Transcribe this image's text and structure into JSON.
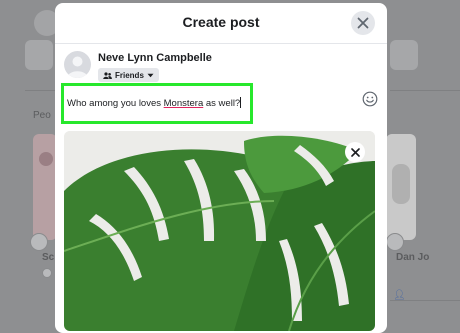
{
  "modal": {
    "title": "Create post",
    "user_name": "Neve Lynn Campbelle",
    "audience_label": "Friends",
    "post_text_before": "Who among you loves ",
    "post_text_highlight": "Monstera",
    "post_text_after": " as well?"
  },
  "background": {
    "section_label_fragment": "Peo",
    "left_card_fragment": "Sc",
    "right_card_fragment": "Dan Jo"
  },
  "icons": {
    "close": "close-icon",
    "audience": "friends-icon",
    "dropdown": "chevron-down-icon",
    "emoji": "emoji-icon",
    "remove_photo": "close-icon"
  },
  "colors": {
    "highlight_border": "#27e82c",
    "overlay": "#8e8f91",
    "modal_bg": "#ffffff",
    "leaf": "#3f8a34"
  }
}
